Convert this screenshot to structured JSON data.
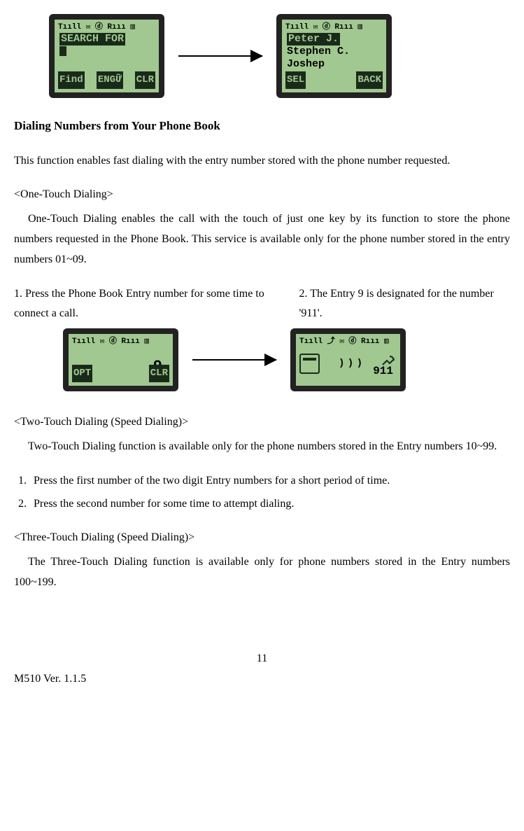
{
  "screens": {
    "s1": {
      "title": "SEARCH FOR",
      "soft_left": "Find",
      "soft_mid": "ENGỮ",
      "soft_right": "CLR",
      "status": "Tııll   ✉ ⓓ Rııı ▥"
    },
    "s2": {
      "row1": "Peter J.",
      "row2": "Stephen C.",
      "row3": "Joshep",
      "soft_left": "SEL",
      "soft_right": "BACK",
      "status": "Tııll   ✉ ⓓ Rııı ▥"
    },
    "s3": {
      "digit": "9",
      "soft_left": "OPT",
      "soft_right": "CLR",
      "status": "Tııll   ✉ ⓓ Rııı ▥"
    },
    "s4": {
      "number": "911",
      "status": "Tııll ⤴ ✉ ⓓ Rııı ▥"
    }
  },
  "h1": "Dialing Numbers from Your Phone Book",
  "p1": "This function enables fast dialing with the entry number stored with the phone number requested.",
  "sub1": "<One-Touch Dialing>",
  "p2": "One-Touch Dialing enables the call with the touch of just one key by its function to store the phone numbers requested in the Phone Book. This service is available only for the phone number stored in the entry numbers 01~09.",
  "step1": "1. Press the Phone Book Entry number for some time to connect a call.",
  "step2": "2. The Entry 9 is designated for the number '911'.",
  "sub2": "<Two-Touch Dialing (Speed Dialing)>",
  "p3": "Two-Touch Dialing function is available only for the phone numbers stored in the Entry numbers 10~99.",
  "li1": "Press the first number of the two digit Entry numbers for a short period of time.",
  "li2": "Press the second number for some time to attempt dialing.",
  "sub3": "<Three-Touch Dialing (Speed Dialing)>",
  "p4": "The Three-Touch Dialing function is available only for phone numbers stored in the Entry numbers 100~199.",
  "page_num": "11",
  "version": "M510    Ver. 1.1.5"
}
